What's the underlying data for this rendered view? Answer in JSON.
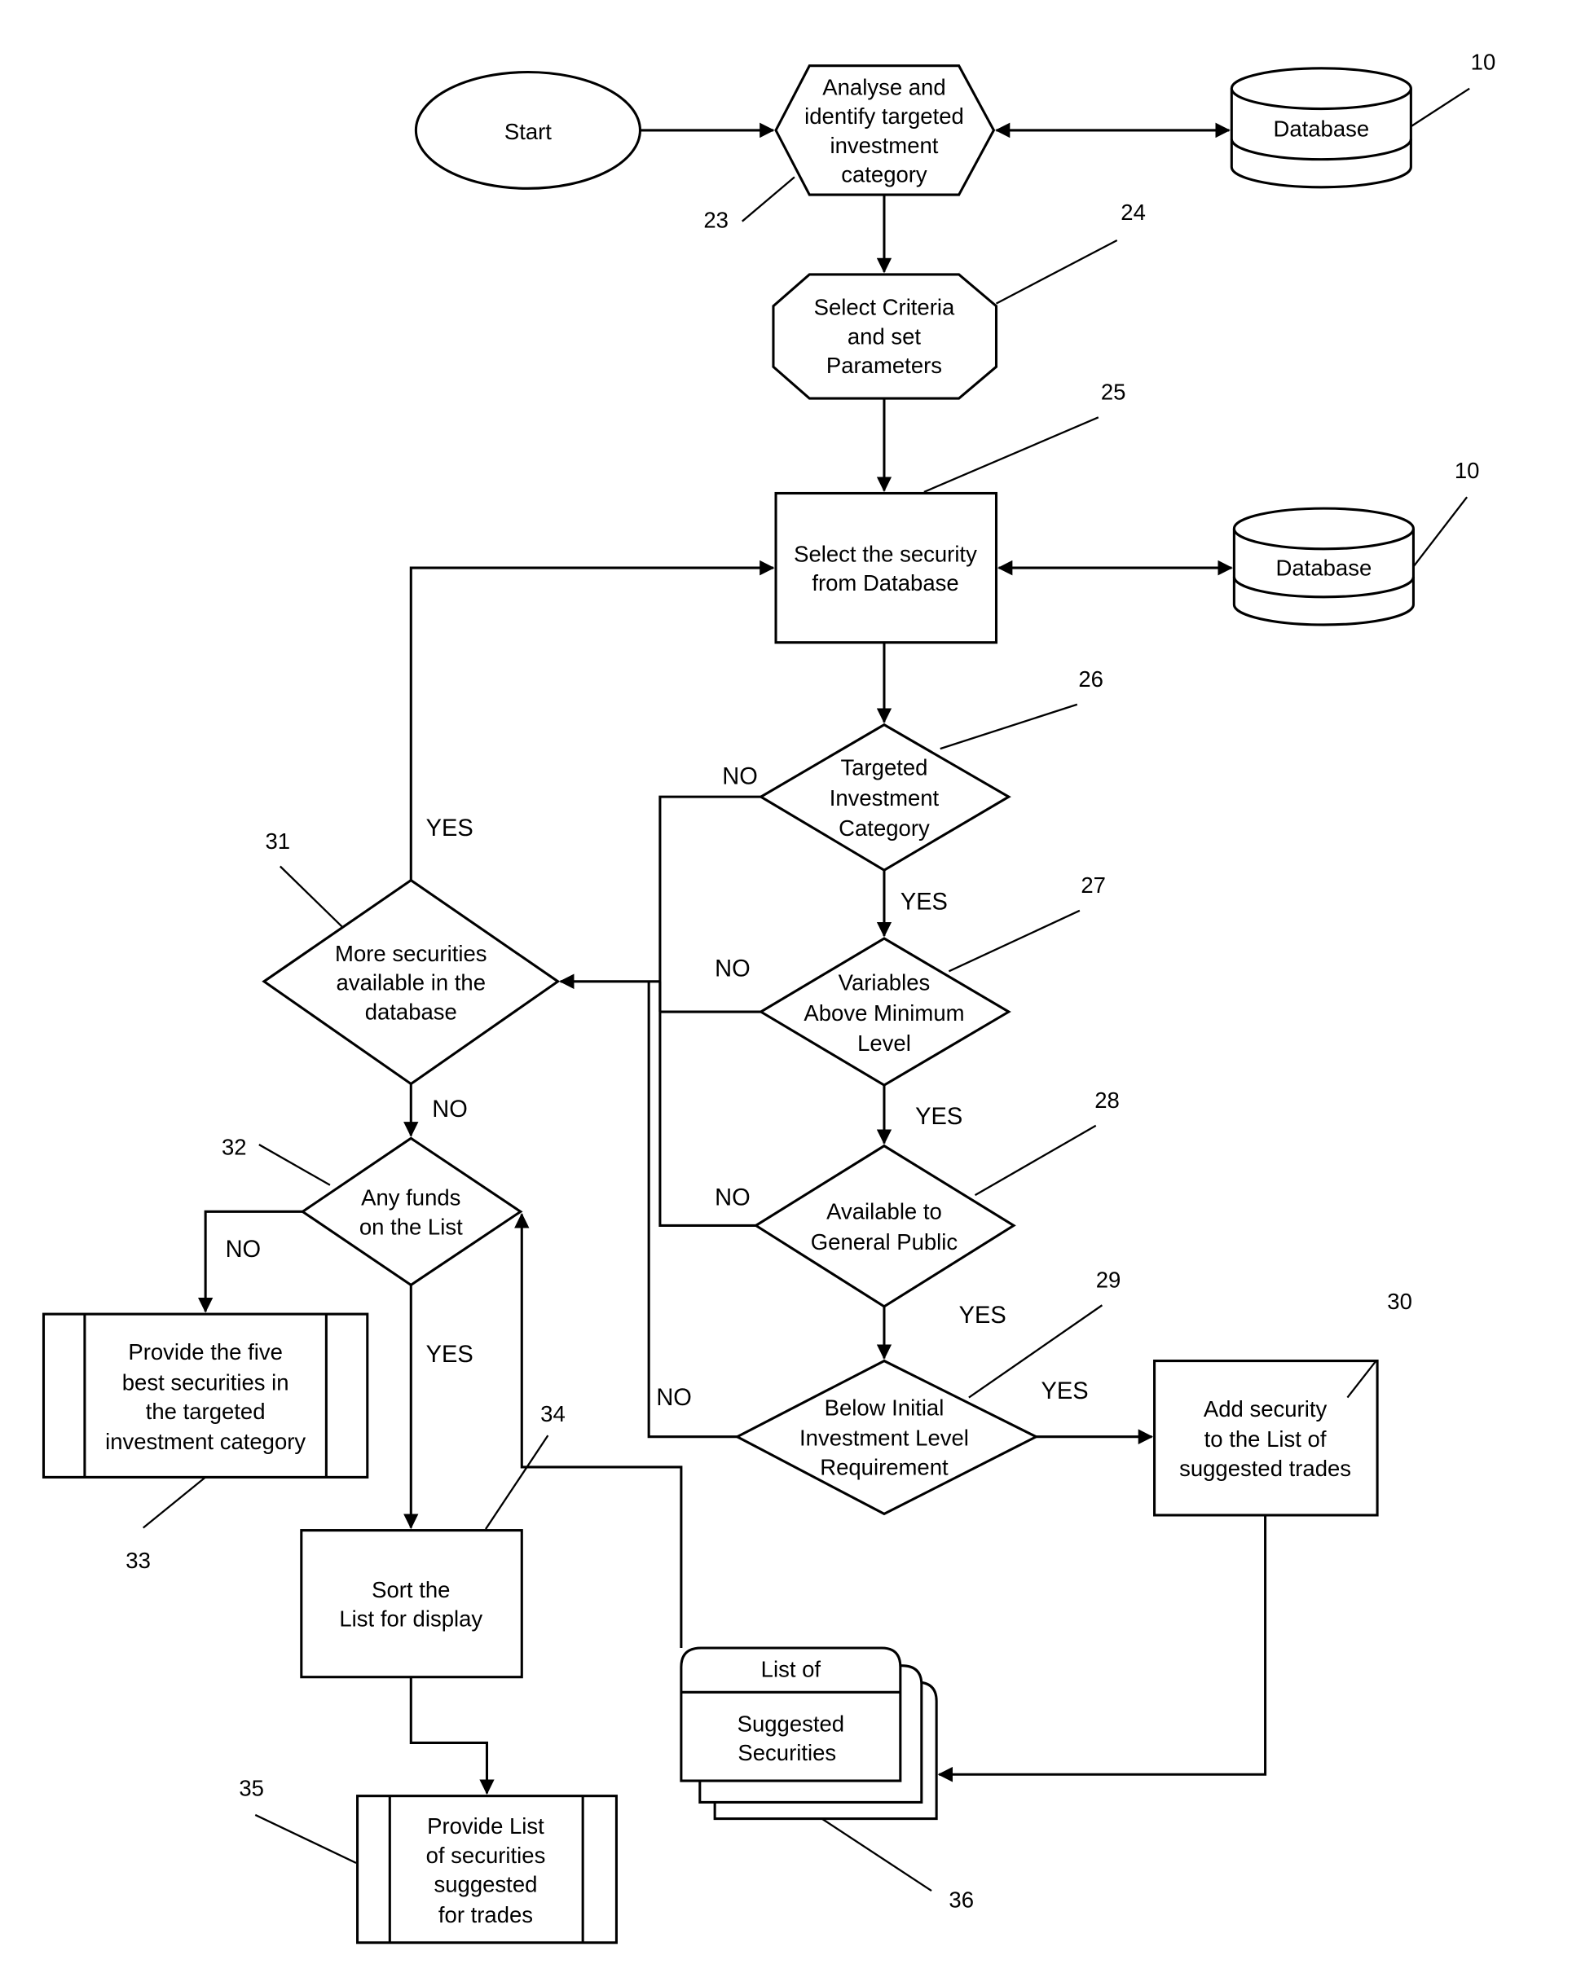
{
  "figure": {
    "type": "patent flowchart",
    "nodes": {
      "start": {
        "lines": [
          "Start"
        ]
      },
      "analyse": {
        "lines": [
          "Analyse and",
          "identify targeted",
          "investment",
          "category"
        ],
        "ref": "23"
      },
      "database_top": {
        "lines": [
          "Database"
        ],
        "ref": "10"
      },
      "criteria": {
        "lines": [
          "Select Criteria",
          "and set",
          "Parameters"
        ],
        "ref": "24"
      },
      "select_security": {
        "lines": [
          "Select the security",
          "from Database"
        ],
        "ref": "25"
      },
      "database_mid": {
        "lines": [
          "Database"
        ],
        "ref": "10"
      },
      "targeted": {
        "lines": [
          "Targeted",
          "Investment",
          "Category"
        ],
        "ref": "26"
      },
      "variables": {
        "lines": [
          "Variables",
          "Above Minimum",
          "Level"
        ],
        "ref": "27"
      },
      "public": {
        "lines": [
          "Available to",
          "General Public"
        ],
        "ref": "28"
      },
      "below": {
        "lines": [
          "Below Initial",
          "Investment Level",
          "Requirement"
        ],
        "ref": "29"
      },
      "add_security": {
        "lines": [
          "Add security",
          "to the List of",
          "suggested trades"
        ],
        "ref": "30"
      },
      "more": {
        "lines": [
          "More securities",
          "available in the",
          "database"
        ],
        "ref": "31"
      },
      "any_funds": {
        "lines": [
          "Any funds",
          "on the List"
        ],
        "ref": "32"
      },
      "five_best": {
        "lines": [
          "Provide the five",
          "best securities in",
          "the targeted",
          "investment category"
        ],
        "ref": "33"
      },
      "sort": {
        "lines": [
          "Sort the",
          "List for display"
        ],
        "ref": "34"
      },
      "provide_list": {
        "lines": [
          "Provide List",
          "of securities",
          "suggested",
          "for trades"
        ],
        "ref": "35"
      },
      "list_doc": {
        "lines": [
          "List of",
          "Suggested",
          "Securities"
        ],
        "ref": "36"
      }
    },
    "edge_labels": {
      "targeted_no": "NO",
      "targeted_yes": "YES",
      "variables_no": "NO",
      "variables_yes": "YES",
      "public_no": "NO",
      "public_yes": "YES",
      "below_no": "NO",
      "below_yes": "YES",
      "more_yes": "YES",
      "more_no": "NO",
      "funds_no": "NO",
      "funds_yes": "YES"
    }
  }
}
